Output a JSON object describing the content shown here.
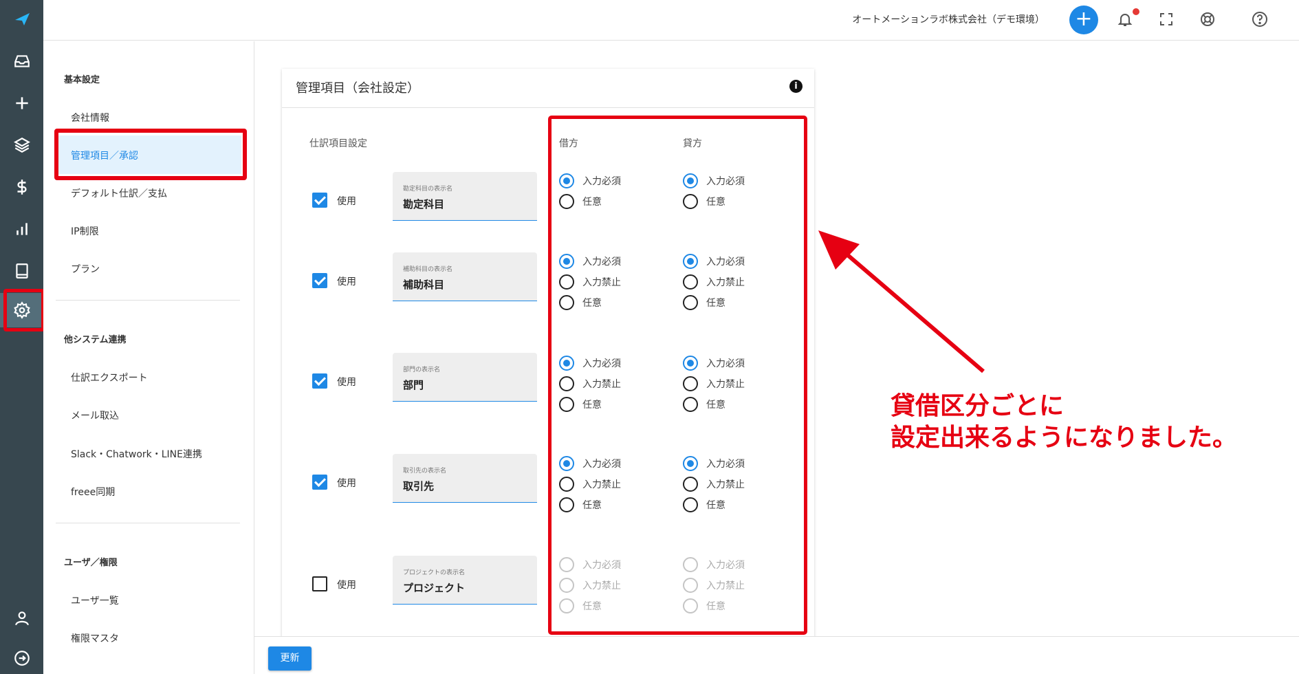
{
  "header": {
    "company": "オートメーションラボ株式会社（デモ環境）"
  },
  "sidebar": {
    "sections": [
      {
        "title": "基本設定",
        "items": [
          "会社情報",
          "管理項目／承認",
          "デフォルト仕訳／支払",
          "IP制限",
          "プラン"
        ]
      },
      {
        "title": "他システム連携",
        "items": [
          "仕訳エクスポート",
          "メール取込",
          "Slack・Chatwork・LINE連携",
          "freee同期"
        ]
      },
      {
        "title": "ユーザ／権限",
        "items": [
          "ユーザ一覧",
          "権限マスタ"
        ]
      }
    ],
    "active_item": "管理項目／承認"
  },
  "card": {
    "title": "管理項目（会社設定）",
    "info_icon": "i",
    "col_settings": "仕訳項目設定",
    "col_debit": "借方",
    "col_credit": "貸方",
    "use_label": "使用",
    "rows": [
      {
        "checked": true,
        "field_label": "勘定科目の表示名",
        "field_value": "勘定科目",
        "disabled": false,
        "options": [
          "入力必須",
          "任意"
        ]
      },
      {
        "checked": true,
        "field_label": "補助科目の表示名",
        "field_value": "補助科目",
        "disabled": false,
        "options": [
          "入力必須",
          "入力禁止",
          "任意"
        ]
      },
      {
        "checked": true,
        "field_label": "部門の表示名",
        "field_value": "部門",
        "disabled": false,
        "options": [
          "入力必須",
          "入力禁止",
          "任意"
        ]
      },
      {
        "checked": true,
        "field_label": "取引先の表示名",
        "field_value": "取引先",
        "disabled": false,
        "options": [
          "入力必須",
          "入力禁止",
          "任意"
        ]
      },
      {
        "checked": false,
        "field_label": "プロジェクトの表示名",
        "field_value": "プロジェクト",
        "disabled": true,
        "options": [
          "入力必須",
          "入力禁止",
          "任意"
        ]
      }
    ]
  },
  "annotation": {
    "line1": "貸借区分ごとに",
    "line2": "設定出来るようになりました。",
    "color": "#e60012"
  },
  "footer": {
    "update_label": "更新"
  },
  "colors": {
    "rail": "#37474f",
    "accent": "#1e88e5",
    "highlight": "#e60012"
  },
  "icons": {
    "rail": [
      "logo-icon",
      "inbox-icon",
      "plus-icon",
      "layers-icon",
      "dollar-icon",
      "bar-chart-icon",
      "book-icon",
      "gear-icon",
      "user-icon",
      "logout-icon"
    ],
    "topbar": [
      "add-icon",
      "bell-icon",
      "fullscreen-icon",
      "support-icon",
      "help-icon"
    ]
  }
}
